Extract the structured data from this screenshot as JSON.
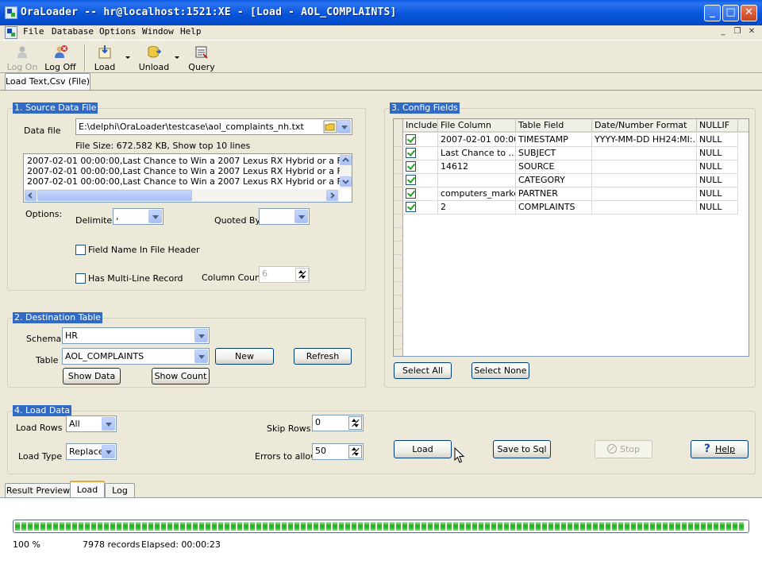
{
  "window": {
    "title": "OraLoader -- hr@localhost:1521:XE - [Load - AOL_COMPLAINTS]",
    "min": "_",
    "max": "□",
    "close": "✕"
  },
  "menu": [
    "File",
    "Database",
    "Options",
    "Window",
    "Help"
  ],
  "mdi_buttons": [
    "_",
    "❐",
    "✕"
  ],
  "toolbar": {
    "logon": "Log On",
    "logoff": "Log Off",
    "load": "Load",
    "unload": "Unload",
    "query": "Query"
  },
  "top_tab": "Load Text,Csv (File)",
  "source": {
    "group_title": "1. Source Data File",
    "data_file_label": "Data file",
    "data_file_value": "E:\\delphi\\OraLoader\\testcase\\aol_complaints_nh.txt",
    "file_info": "File Size: 672.582 KB,  Show top 10 lines",
    "preview_lines": [
      "2007-02-01 00:00:00,Last Chance to Win a 2007 Lexus RX Hybrid or a Fujitsu LifeB",
      "2007-02-01 00:00:00,Last Chance to Win a 2007 Lexus RX Hybrid or a Fujitsu LifeB",
      "2007-02-01 00:00:00,Last Chance to Win a 2007 Lexus RX Hybrid or a Fujitsu LifeB"
    ],
    "options_label": "Options:",
    "delimiter_label": "Delimiter",
    "delimiter_value": ",",
    "quoted_by_label": "Quoted By",
    "quoted_by_value": "",
    "field_name_header_label": "Field Name In File Header",
    "multiline_label": "Has Multi-Line Record",
    "column_count_label": "Column Count",
    "column_count_value": "6"
  },
  "destination": {
    "group_title": "2. Destination Table",
    "schema_label": "Schema",
    "schema_value": "HR",
    "table_label": "Table",
    "table_value": "AOL_COMPLAINTS",
    "new_button": "New",
    "refresh_button": "Refresh",
    "show_data_button": "Show Data",
    "show_count_button": "Show Count"
  },
  "config": {
    "group_title": "3. Config Fields",
    "columns": [
      "Include",
      "File Column",
      "Table Field",
      "Date/Number Format",
      "NULLIF"
    ],
    "rows": [
      {
        "include": true,
        "file_column": "2007-02-01 00:00...",
        "table_field": "TIMESTAMP",
        "format": "YYYY-MM-DD HH24:MI:...",
        "nullif": "NULL"
      },
      {
        "include": true,
        "file_column": "Last Chance to ...",
        "table_field": "SUBJECT",
        "format": "",
        "nullif": "NULL"
      },
      {
        "include": true,
        "file_column": "14612",
        "table_field": "SOURCE",
        "format": "",
        "nullif": "NULL"
      },
      {
        "include": true,
        "file_column": "",
        "table_field": "CATEGORY",
        "format": "",
        "nullif": "NULL"
      },
      {
        "include": true,
        "file_column": "computers_marke...",
        "table_field": "PARTNER",
        "format": "",
        "nullif": "NULL"
      },
      {
        "include": true,
        "file_column": "2",
        "table_field": "COMPLAINTS",
        "format": "",
        "nullif": "NULL"
      }
    ],
    "select_all_button": "Select All",
    "select_none_button": "Select None"
  },
  "load_data": {
    "group_title": "4. Load Data",
    "load_rows_label": "Load Rows",
    "load_rows_value": "All",
    "load_type_label": "Load Type",
    "load_type_value": "Replace",
    "skip_rows_label": "Skip Rows",
    "skip_rows_value": "0",
    "errors_label": "Errors to allow",
    "errors_value": "50",
    "load_button": "Load",
    "save_sql_button": "Save to Sql",
    "stop_button": "Stop",
    "help_button": "Help"
  },
  "bottom_tabs": [
    "Result Preview",
    "Load",
    "Log"
  ],
  "status": {
    "progress": 1.0,
    "percent": "100 %",
    "records": "7978 records",
    "elapsed": "Elapsed: 00:00:23"
  },
  "colors": {
    "titlebar": "#0754d8",
    "group_title_bg": "#316ac5",
    "progress_green": "#27b322"
  }
}
